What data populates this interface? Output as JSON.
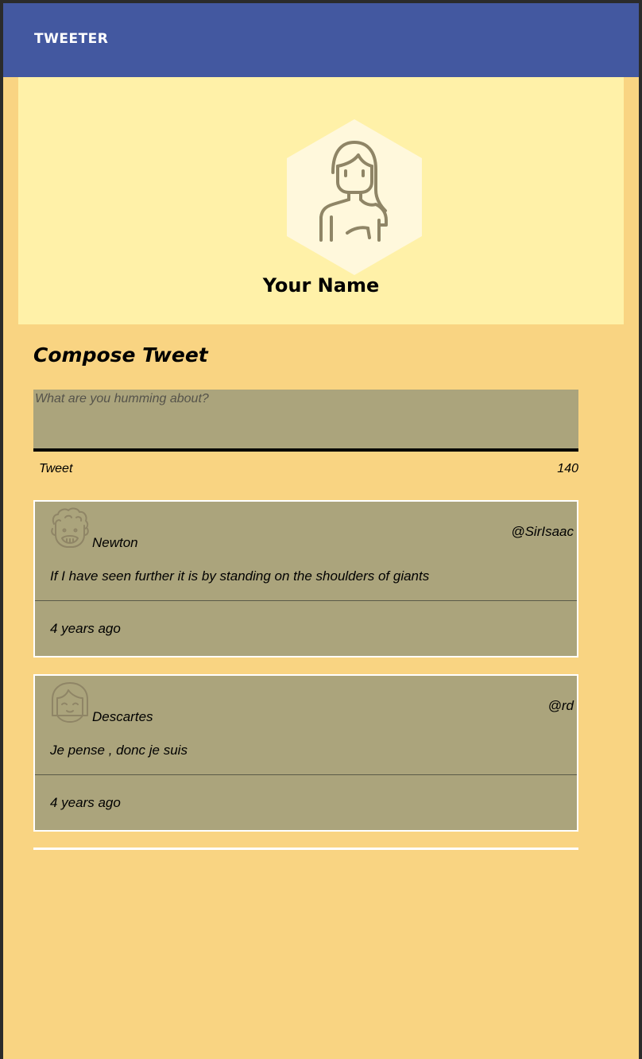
{
  "navbar": {
    "brand": "TWEETER",
    "background": "#4358a0"
  },
  "profile": {
    "name": "Your Name",
    "avatar_icon": "woman-avatar-icon",
    "background": "#fff1a8"
  },
  "compose": {
    "title": "Compose Tweet",
    "placeholder": "What are you humming about?",
    "value": "",
    "tweet_label": "Tweet",
    "counter": "140"
  },
  "tweets": [
    {
      "author": "Newton",
      "handle": "@SirIsaac",
      "text": "If I have seen further it is by standing on the shoulders of giants",
      "time": "4 years ago",
      "avatar_icon": "curly-haired-man-avatar-icon"
    },
    {
      "author": "Descartes",
      "handle": "@rd",
      "text": "Je pense , donc je suis",
      "time": "4 years ago",
      "avatar_icon": "bob-haired-avatar-icon"
    }
  ],
  "colors": {
    "page_background": "#f9d482",
    "tweet_background": "#aba47c",
    "icon_stroke": "#8f8566"
  }
}
